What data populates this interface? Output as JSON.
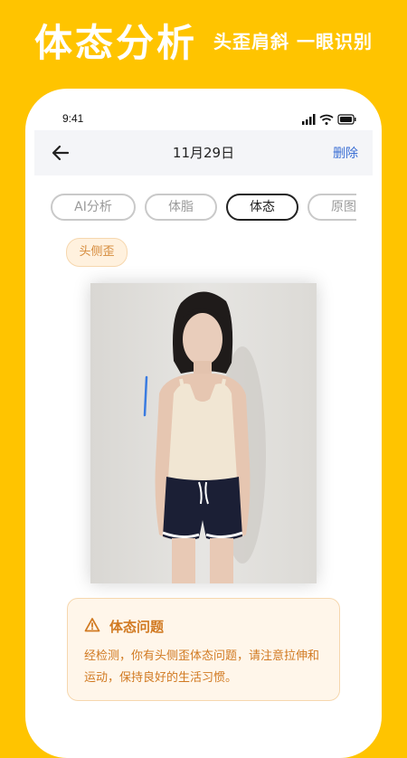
{
  "promo": {
    "title": "体态分析",
    "subtitle": "头歪肩斜 一眼识别"
  },
  "status_bar": {
    "time": "9:41"
  },
  "nav": {
    "back_icon": "arrow-left-icon",
    "title": "11月29日",
    "delete_label": "删除"
  },
  "tabs": [
    {
      "label": "AI分析",
      "active": false
    },
    {
      "label": "体脂",
      "active": false
    },
    {
      "label": "体态",
      "active": true
    },
    {
      "label": "原图",
      "active": false
    }
  ],
  "issue_tag": {
    "label": "头侧歪"
  },
  "notice": {
    "icon": "warning-icon",
    "title": "体态问题",
    "body": "经检测，你有头侧歪体态问题，请注意拉伸和运动，保持良好的生活习惯。"
  },
  "colors": {
    "brand_yellow": "#FFC400",
    "accent_blue": "#3B6FD4",
    "warning_orange": "#D17A22",
    "marker_blue": "#3A7BE0"
  }
}
